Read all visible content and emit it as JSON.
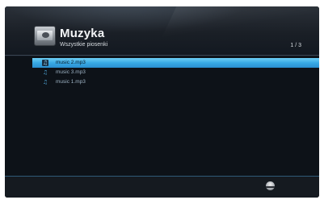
{
  "header": {
    "title": "Muzyka",
    "subtitle": "Wszystkie piosenki",
    "page_counter": "1 / 3",
    "icon": "music-player-icon"
  },
  "list": {
    "items": [
      {
        "label": "music 2.mp3",
        "icon": "music-note-icon",
        "selected": true
      },
      {
        "label": "music 3.mp3",
        "icon": "music-note-icon",
        "selected": false
      },
      {
        "label": "music 1.mp3",
        "icon": "music-note-icon",
        "selected": false
      }
    ]
  },
  "footer": {
    "icon": "disc-button-icon"
  },
  "colors": {
    "selection": "#38a9e4",
    "background": "#0d1218",
    "text": "#f2f4f6",
    "accent_line": "#2f5a78"
  }
}
